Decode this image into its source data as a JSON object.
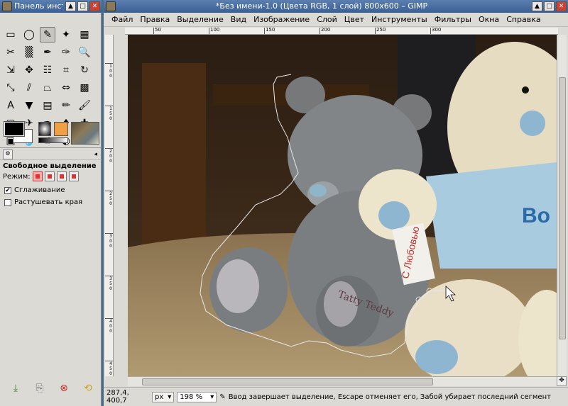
{
  "toolbox": {
    "title": "Панель инструм",
    "tools": [
      "rect-select-icon",
      "ellipse-select-icon",
      "free-select-icon",
      "fuzzy-select-icon",
      "color-select-icon",
      "scissors-select-icon",
      "foreground-select-icon",
      "paths-icon",
      "color-picker-icon",
      "zoom-icon",
      "measure-icon",
      "move-icon",
      "align-icon",
      "crop-icon",
      "rotate-icon",
      "scale-icon",
      "shear-icon",
      "perspective-icon",
      "flip-icon",
      "cage-icon",
      "text-icon",
      "bucket-fill-icon",
      "blend-icon",
      "pencil-icon",
      "paintbrush-icon",
      "eraser-icon",
      "airbrush-icon",
      "ink-icon",
      "clone-icon",
      "heal-icon",
      "perspective-clone-icon",
      "blur-icon",
      "smudge-icon",
      "dodge-burn-icon"
    ],
    "tool_glyphs": [
      "▭",
      "◯",
      "✎",
      "✦",
      "▦",
      "✂",
      "▒",
      "✒",
      "✑",
      "🔍",
      "⇲",
      "✥",
      "☷",
      "⌗",
      "↻",
      "⤡",
      "⫽",
      "⏢",
      "⇔",
      "▩",
      "A",
      "▼",
      "▤",
      "✏",
      "🖌",
      "▢",
      "✈",
      "✒",
      "♦",
      "✚",
      "▣",
      "💧",
      "☝",
      "◐"
    ],
    "active_tool_index": 2,
    "options_title": "Свободное выделение",
    "mode_label": "Режим:",
    "antialias_label": "Сглаживание",
    "antialias_checked": "✔",
    "feather_label": "Растушевать края"
  },
  "image_window": {
    "title": "*Без имени-1.0 (Цвета RGB, 1 слой) 800x600 – GIMP",
    "menu": [
      "Файл",
      "Правка",
      "Выделение",
      "Вид",
      "Изображение",
      "Слой",
      "Цвет",
      "Инструменты",
      "Фильтры",
      "Окна",
      "Справка"
    ],
    "hruler_labels": [
      "50",
      "100",
      "150",
      "200",
      "250",
      "300"
    ],
    "vruler_labels": [
      "1\n0\n0",
      "1\n5\n0",
      "2\n0\n0",
      "2\n5\n0",
      "3\n0\n0",
      "3\n5\n0",
      "4\n0\n0",
      "4\n5\n0"
    ],
    "status": {
      "coords": "287,4, 400,7",
      "unit": "px",
      "zoom": "198 %",
      "message": "Ввод завершает выделение, Escape отменяет его, Забой убирает последний сегмент"
    }
  },
  "photo": {
    "tag_text": "С Любовью",
    "foot_text": "Tatty Teddy",
    "shirt_text": "Bo"
  }
}
